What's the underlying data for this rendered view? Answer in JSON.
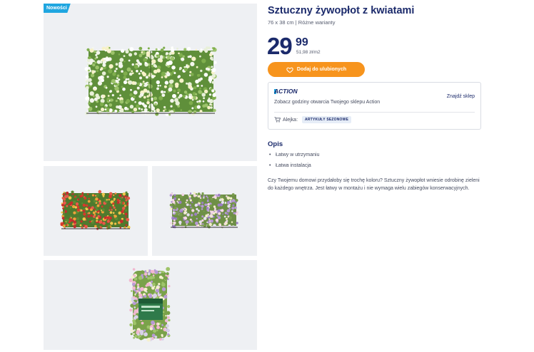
{
  "badge": {
    "label": "Nowości"
  },
  "product": {
    "title": "Sztuczny żywopłot z kwiatami",
    "subtitle": "76 x 38 cm | Różne warianty",
    "price_main": "29",
    "price_cents": "99",
    "unit_price": "51,98 zł/m2",
    "favorite_label": "Dodaj do ulubionych"
  },
  "store": {
    "logo": "ACTION",
    "hours_text": "Zobacz godziny otwarcia Twojego sklepu Action",
    "find_store": "Znajdź sklep",
    "aisle_label": "Alejka:",
    "aisle_value": "ARTYKUŁY SEZONOWE"
  },
  "description": {
    "heading": "Opis",
    "bullets": [
      "Łatwy w utrzymaniu",
      "Łatwa instalacja"
    ],
    "text": "Czy Twojemu domowi przydałoby się trochę koloru? Sztuczny żywopłot wniesie odrobinę zieleni do każdego wnętrza. Jest łatwy w montażu i nie wymaga wielu zabiegów konserwacyjnych."
  },
  "colors": {
    "brand_navy": "#1b2a6b",
    "accent_orange": "#f7941d",
    "badge_blue": "#1fa6e0",
    "tile_bg": "#eef0f3"
  },
  "icons": [
    "heart-icon",
    "cart-icon"
  ]
}
